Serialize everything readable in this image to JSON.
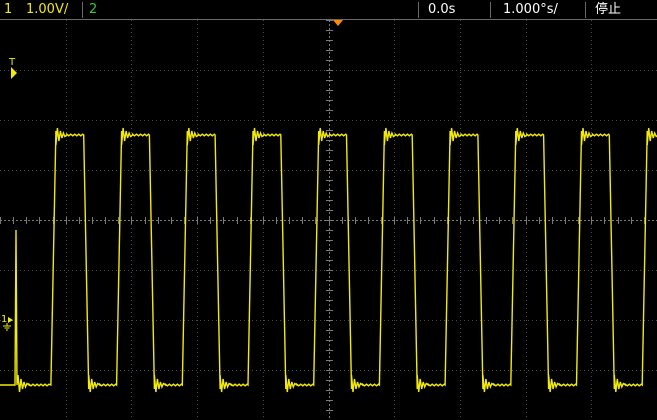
{
  "colors": {
    "channel1": "#f2ea0c",
    "channel2": "#37c437",
    "trigger_marker": "#ff8c00",
    "grid": "#4a4a4a",
    "center_axis": "#7a7a7a",
    "background": "#000000"
  },
  "status_bar": {
    "channel1_number": "1",
    "channel1_scale": "1.00V/",
    "channel2_number": "2",
    "time_offset": "0.0s",
    "time_scale": "1.000°s/",
    "run_state": "停止"
  },
  "screen_markers": {
    "trigger_level_label": "T",
    "channel1_ground_label": "1"
  },
  "icons": {
    "trigger_position": "trigger-position-icon",
    "trigger_level": "trigger-level-icon",
    "ground_reference": "ground-icon"
  },
  "waveform": {
    "channel": "1",
    "shape": "square",
    "high_level_divisions": 1.7,
    "low_level_divisions": -3.3,
    "cycles_visible": 10,
    "duty_cycle": 0.5,
    "ringing_at_edges": true
  }
}
